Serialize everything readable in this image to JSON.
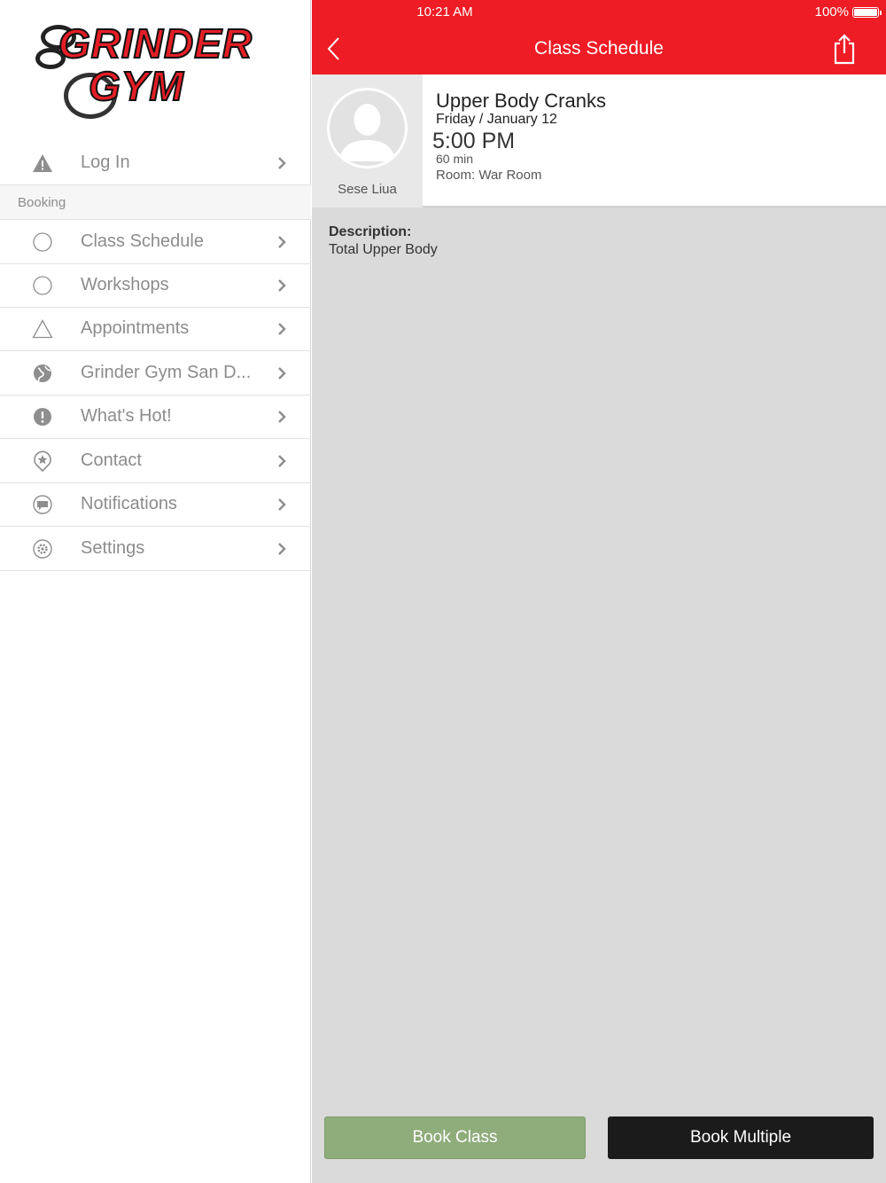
{
  "status": {
    "time": "10:21 AM",
    "battery": "100%",
    "battery_level": 1.0
  },
  "logo": {
    "line1": "GRINDER",
    "line2": "GYM"
  },
  "sidebar": {
    "login_label": "Log In",
    "section_label": "Booking",
    "items": [
      {
        "label": "Class Schedule",
        "icon": "circle-icon"
      },
      {
        "label": "Workshops",
        "icon": "circle-icon"
      },
      {
        "label": "Appointments",
        "icon": "triangle-icon"
      },
      {
        "label": "Grinder Gym San D...",
        "icon": "globe-icon"
      },
      {
        "label": "What's Hot!",
        "icon": "exclamation-icon"
      },
      {
        "label": "Contact",
        "icon": "location-pin-icon"
      },
      {
        "label": "Notifications",
        "icon": "chat-bubble-icon"
      },
      {
        "label": "Settings",
        "icon": "gear-icon"
      }
    ]
  },
  "navbar": {
    "title": "Class Schedule"
  },
  "class": {
    "instructor": "Sese Liua",
    "title": "Upper Body Cranks",
    "date": "Friday / January 12",
    "time": "5:00 PM",
    "duration": "60 min",
    "room": "Room: War Room",
    "description_label": "Description:",
    "description": "Total Upper Body"
  },
  "actions": {
    "book_label": "Book Class",
    "multiple_label": "Book Multiple"
  },
  "colors": {
    "brand_red": "#ee1c25",
    "book_green": "#8fac7b",
    "dark_button": "#1b1b1b",
    "content_bg": "#d9dad9"
  }
}
